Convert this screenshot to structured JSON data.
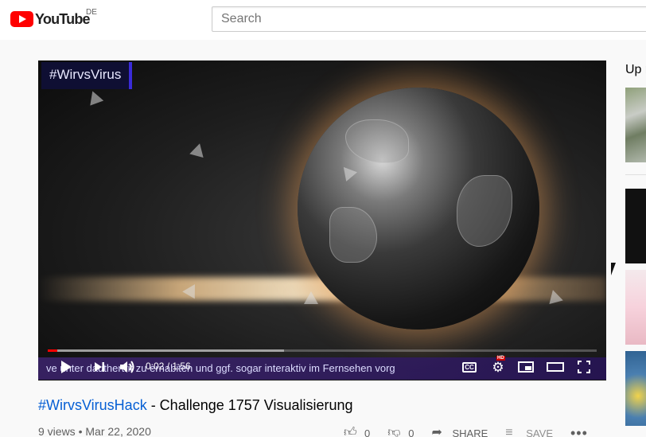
{
  "header": {
    "logo_text": "YouTube",
    "country_code": "DE",
    "search_placeholder": "Search"
  },
  "player": {
    "brand_overlay": "#WirvsVirus",
    "ticker_text": "ve unter dauthertrit zu ernabiten und ggf. sogar interaktiv im Fernsehen vorg",
    "time_display": "0:02 / 1:56",
    "progress_fraction": 0.017,
    "buffer_fraction": 0.43,
    "controls": {
      "play_icon": "play-icon",
      "next_icon": "skip-next-icon",
      "volume_icon": "volume-icon",
      "cc_label": "CC",
      "hd_badge": "HD"
    }
  },
  "video": {
    "title_hashtag": "#WirvsVirusHack",
    "title_rest": " - Challenge 1757 Visualisierung",
    "views": "9 views",
    "separator": "•",
    "date": "Mar 22, 2020",
    "likes": "0",
    "dislikes": "0",
    "share_label": "SHARE",
    "save_label": "SAVE",
    "more_label": "•••"
  },
  "sidebar": {
    "heading": "Up next"
  },
  "colors": {
    "accent": "#ff0000",
    "link": "#065fd4",
    "text_secondary": "#606060"
  }
}
